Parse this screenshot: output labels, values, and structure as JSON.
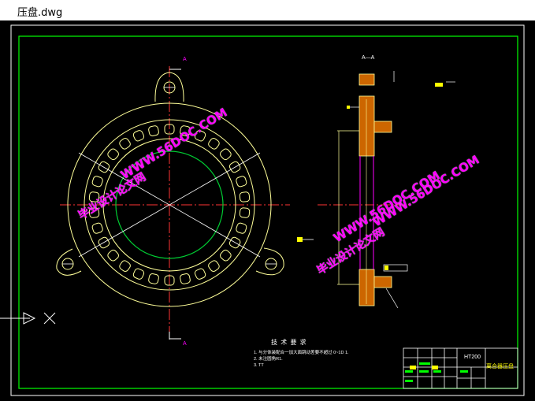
{
  "window": {
    "title": "压盘.dwg"
  },
  "drawing": {
    "section_label": "A—A",
    "cut_label_top": "A",
    "cut_label_bottom": "A",
    "tech_title": "技 术 要 求",
    "tech_notes": [
      "1. 与分体装配合一加大面跳动差要不超过 0~1D 1.",
      "2. 未注圆角R1.",
      "3. TT"
    ],
    "title_block": {
      "material": "HT200",
      "part_name": "离合器压盘"
    },
    "watermarks": [
      "WWW.56DOC.COM",
      "毕业设计论文网",
      "WWW.56DOC.COM",
      "毕业设计论文网",
      "WWW.56DOC.COM"
    ]
  },
  "colors": {
    "background": "#000000",
    "border": "#00ff00",
    "outline": "#ffff99",
    "inner_circle": "#00cc33",
    "centerline": "#ff0000",
    "section_fill": "#cc6600",
    "magenta": "#ff00ff",
    "tag": "#ffff00"
  }
}
